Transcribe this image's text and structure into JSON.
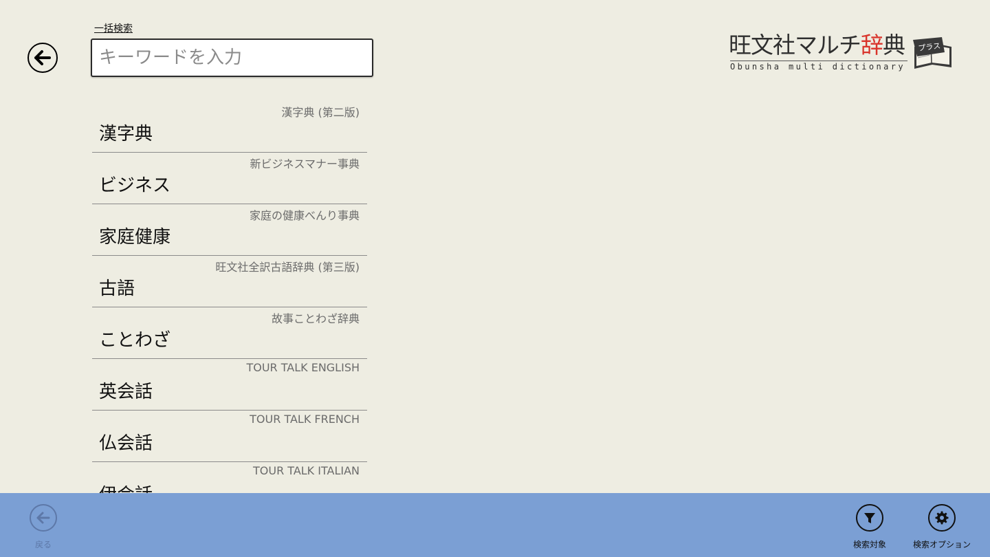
{
  "header": {
    "search_label": "一括検索",
    "search_placeholder": "キーワードを入力"
  },
  "logo": {
    "title_main": "旺文社マルチ",
    "title_accent": "辞",
    "title_end": "典",
    "subtitle": "Obunsha multi dictionary",
    "badge": "プラス"
  },
  "dictionaries": [
    {
      "title": "漢字典",
      "subtitle": "漢字典 (第二版)"
    },
    {
      "title": "ビジネス",
      "subtitle": "新ビジネスマナー事典"
    },
    {
      "title": "家庭健康",
      "subtitle": "家庭の健康べんり事典"
    },
    {
      "title": "古語",
      "subtitle": "旺文社全訳古語辞典 (第三版)"
    },
    {
      "title": "ことわざ",
      "subtitle": "故事ことわざ辞典"
    },
    {
      "title": "英会話",
      "subtitle": "TOUR TALK ENGLISH"
    },
    {
      "title": "仏会話",
      "subtitle": "TOUR TALK FRENCH"
    },
    {
      "title": "伊会話",
      "subtitle": "TOUR TALK ITALIAN"
    }
  ],
  "app_bar": {
    "back_label": "戻る",
    "filter_label": "検索対象",
    "options_label": "検索オプション"
  },
  "colors": {
    "background": "#eeede2",
    "app_bar": "#7b9fd4",
    "logo_accent": "#d9342b"
  }
}
